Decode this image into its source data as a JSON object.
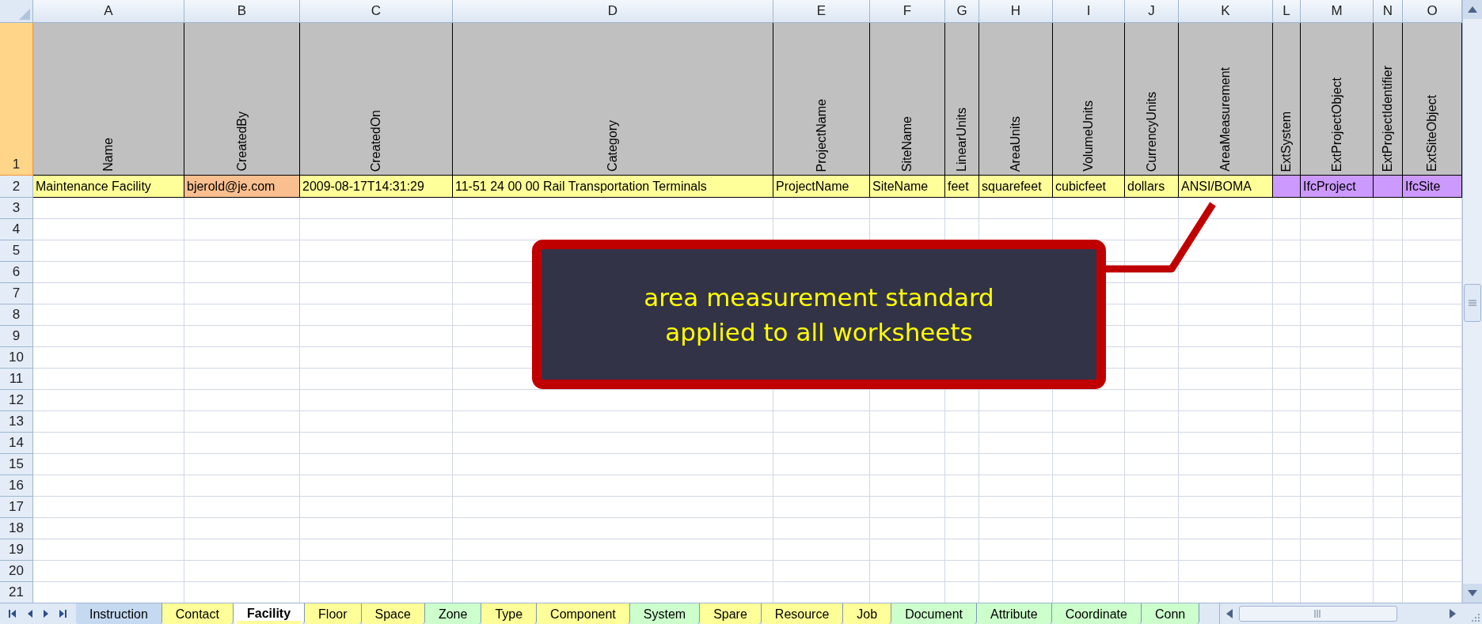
{
  "columns": [
    "A",
    "B",
    "C",
    "D",
    "E",
    "F",
    "G",
    "H",
    "I",
    "J",
    "K",
    "L",
    "M",
    "N",
    "O"
  ],
  "rows": [
    {
      "number": "1",
      "selected": true,
      "kind": "header",
      "cells": [
        "Name",
        "CreatedBy",
        "CreatedOn",
        "Category",
        "ProjectName",
        "SiteName",
        "LinearUnits",
        "AreaUnits",
        "VolumeUnits",
        "CurrencyUnits",
        "AreaMeasurement",
        "ExtSystem",
        "ExtProjectObject",
        "ExtProjectIdentifier",
        "ExtSiteObject"
      ]
    },
    {
      "number": "2",
      "selected": false,
      "kind": "data",
      "cells": [
        {
          "text": "Maintenance Facility",
          "color": "#ffff99"
        },
        {
          "text": "bjerold@je.com",
          "color": "#fabf8f"
        },
        {
          "text": "2009-08-17T14:31:29",
          "color": "#ffff99"
        },
        {
          "text": "11-51 24 00 00 Rail Transportation Terminals",
          "color": "#ffff99"
        },
        {
          "text": "ProjectName",
          "color": "#ffff99"
        },
        {
          "text": "SiteName",
          "color": "#ffff99"
        },
        {
          "text": "feet",
          "color": "#ffff99"
        },
        {
          "text": "squarefeet",
          "color": "#ffff99"
        },
        {
          "text": "cubicfeet",
          "color": "#ffff99"
        },
        {
          "text": "dollars",
          "color": "#ffff99"
        },
        {
          "text": "ANSI/BOMA",
          "color": "#ffff99"
        },
        {
          "text": "",
          "color": "#cc99ff"
        },
        {
          "text": "IfcProject",
          "color": "#cc99ff"
        },
        {
          "text": "",
          "color": "#cc99ff"
        },
        {
          "text": "IfcSite",
          "color": "#cc99ff"
        }
      ]
    },
    {
      "number": "3",
      "selected": false,
      "kind": "empty"
    },
    {
      "number": "4",
      "selected": false,
      "kind": "empty"
    },
    {
      "number": "5",
      "selected": false,
      "kind": "empty"
    },
    {
      "number": "6",
      "selected": false,
      "kind": "empty"
    },
    {
      "number": "7",
      "selected": false,
      "kind": "empty"
    },
    {
      "number": "8",
      "selected": false,
      "kind": "empty"
    },
    {
      "number": "9",
      "selected": false,
      "kind": "empty"
    },
    {
      "number": "10",
      "selected": false,
      "kind": "empty"
    },
    {
      "number": "11",
      "selected": false,
      "kind": "empty"
    },
    {
      "number": "12",
      "selected": false,
      "kind": "empty"
    },
    {
      "number": "13",
      "selected": false,
      "kind": "empty"
    },
    {
      "number": "14",
      "selected": false,
      "kind": "empty"
    },
    {
      "number": "15",
      "selected": false,
      "kind": "empty"
    },
    {
      "number": "16",
      "selected": false,
      "kind": "empty"
    },
    {
      "number": "17",
      "selected": false,
      "kind": "empty"
    },
    {
      "number": "18",
      "selected": false,
      "kind": "empty"
    },
    {
      "number": "19",
      "selected": false,
      "kind": "empty"
    },
    {
      "number": "20",
      "selected": false,
      "kind": "empty"
    },
    {
      "number": "21",
      "selected": false,
      "kind": "empty"
    }
  ],
  "callout": {
    "lines": [
      "area measurement standard",
      "applied to all worksheets"
    ]
  },
  "sheet_tabs": [
    {
      "label": "Instruction",
      "selected": false,
      "color": "#c5d9f1"
    },
    {
      "label": "Contact",
      "selected": false,
      "color": "#ffff99"
    },
    {
      "label": "Facility",
      "selected": true,
      "color": "#ffff99"
    },
    {
      "label": "Floor",
      "selected": false,
      "color": "#ffff99"
    },
    {
      "label": "Space",
      "selected": false,
      "color": "#ffff99"
    },
    {
      "label": "Zone",
      "selected": false,
      "color": "#ccffcc"
    },
    {
      "label": "Type",
      "selected": false,
      "color": "#ffff99"
    },
    {
      "label": "Component",
      "selected": false,
      "color": "#ffff99"
    },
    {
      "label": "System",
      "selected": false,
      "color": "#ccffcc"
    },
    {
      "label": "Spare",
      "selected": false,
      "color": "#ffff99"
    },
    {
      "label": "Resource",
      "selected": false,
      "color": "#ffff99"
    },
    {
      "label": "Job",
      "selected": false,
      "color": "#ffff99"
    },
    {
      "label": "Document",
      "selected": false,
      "color": "#ccffcc"
    },
    {
      "label": "Attribute",
      "selected": false,
      "color": "#ccffcc"
    },
    {
      "label": "Coordinate",
      "selected": false,
      "color": "#ccffcc"
    },
    {
      "label": "Conn",
      "selected": false,
      "color": "#ccffcc"
    }
  ]
}
